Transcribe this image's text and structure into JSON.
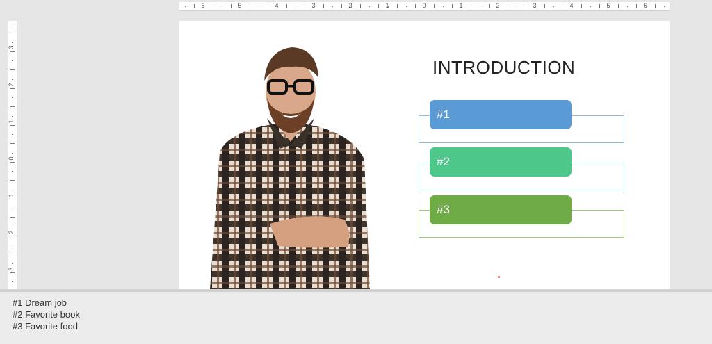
{
  "ruler": {
    "horizontal": [
      "6",
      "5",
      "4",
      "3",
      "2",
      "1",
      "0",
      "1",
      "2",
      "3",
      "4",
      "5",
      "6"
    ],
    "vertical": [
      "3",
      "2",
      "1",
      "0",
      "1",
      "2",
      "3"
    ]
  },
  "slide": {
    "title": "INTRODUCTION",
    "items": [
      {
        "label": "#1",
        "color": "#5b9bd5",
        "outline": "#8fbcd8"
      },
      {
        "label": "#2",
        "color": "#4ec78b",
        "outline": "#7fc9a8"
      },
      {
        "label": "#3",
        "color": "#6fac46",
        "outline": "#9bc97f"
      }
    ]
  },
  "notes": {
    "lines": [
      "#1 Dream job",
      "#2 Favorite book",
      "#3 Favorite food"
    ]
  }
}
